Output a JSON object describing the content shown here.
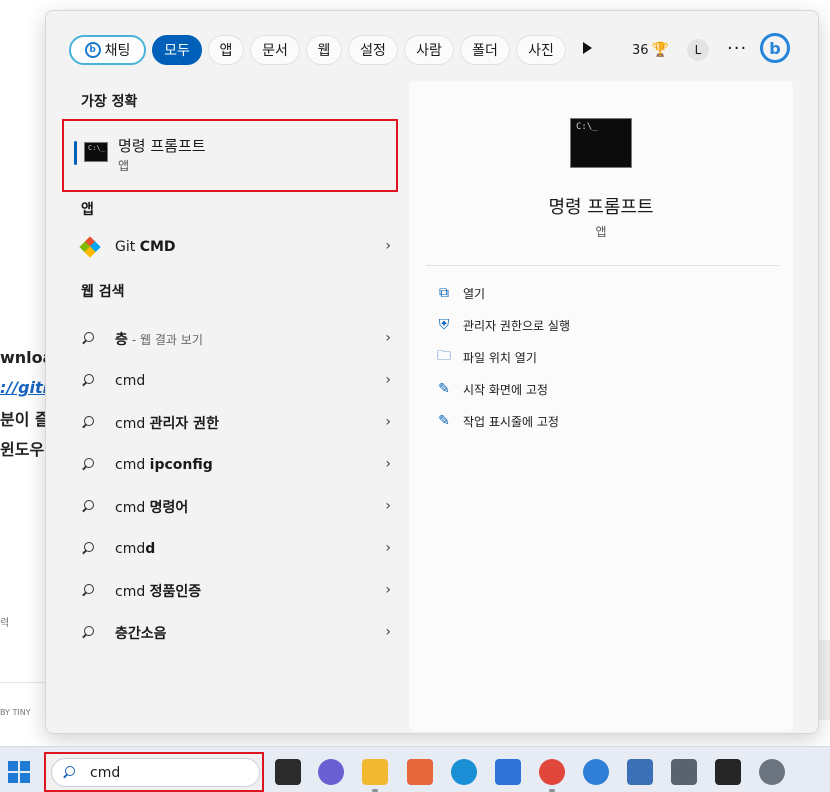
{
  "background": {
    "frag1": "wnloa",
    "frag2": "://gith",
    "frag3": "분이 즐",
    "frag4": "윈도우",
    "frag5": "력",
    "frag6": "BY TINY"
  },
  "filters": {
    "chat": "채팅",
    "items": [
      "모두",
      "앱",
      "문서",
      "웹",
      "설정",
      "사람",
      "폴더",
      "사진"
    ],
    "points": "36",
    "avatar": "L",
    "more": "···"
  },
  "best_match": {
    "header": "가장 정확",
    "title": "명령 프롬프트",
    "subtitle": "앱"
  },
  "apps": {
    "header": "앱",
    "item_bold": "CMD",
    "item_prefix": "Git "
  },
  "web": {
    "header": "웹 검색",
    "items": [
      {
        "main": "층",
        "hint": "- 웹 결과 보기"
      },
      {
        "main": "cmd",
        "hint": ""
      },
      {
        "main": "cmd ",
        "bold": "관리자 권한"
      },
      {
        "main": "cmd ",
        "bold": "ipconfig"
      },
      {
        "main": "cmd ",
        "bold": "명령어"
      },
      {
        "main": "cmd",
        "bold": "d"
      },
      {
        "main": "cmd ",
        "bold": "정품인증"
      },
      {
        "main": "",
        "bold": "층간소음"
      }
    ]
  },
  "detail": {
    "title": "명령 프롬프트",
    "subtitle": "앱",
    "actions": [
      "열기",
      "관리자 권한으로 실행",
      "파일 위치 열기",
      "시작 화면에 고정",
      "작업 표시줄에 고정"
    ]
  },
  "taskbar": {
    "search_value": "cmd"
  },
  "colors": {
    "accent": "#005fb8",
    "highlight_border": "#e0141e",
    "chat_border": "#48b3d9"
  }
}
